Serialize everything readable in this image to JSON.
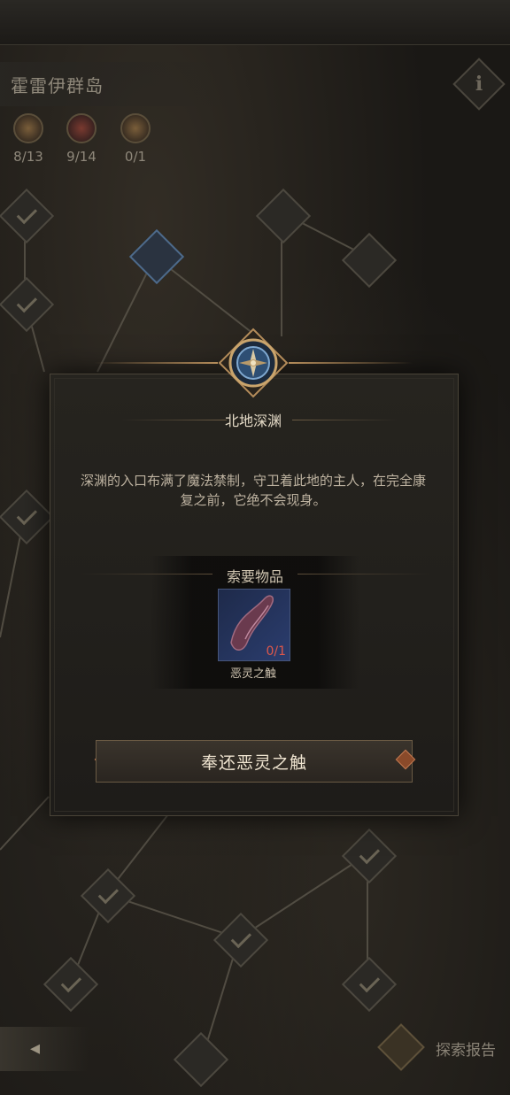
{
  "region": {
    "title": "霍雷伊群岛"
  },
  "info_button": {
    "glyph": "i"
  },
  "counters": [
    {
      "icon": "chest-icon",
      "value": "8/13"
    },
    {
      "icon": "red-chest-icon",
      "value": "9/14"
    },
    {
      "icon": "relic-icon",
      "value": "0/1"
    }
  ],
  "modal": {
    "title": "北地深渊",
    "description": "深渊的入口布满了魔法禁制，守卫着此地的主人，在完全康复之前，它绝不会现身。",
    "requirement_label": "索要物品",
    "item": {
      "name": "恶灵之触",
      "count": "0/1",
      "icon": "tentacle-icon"
    },
    "action_label": "奉还恶灵之触"
  },
  "footer": {
    "back_glyph": "◂",
    "report_label": "探索报告"
  },
  "colors": {
    "accent_gold": "#b48c5a",
    "count_red": "#e0584a"
  }
}
